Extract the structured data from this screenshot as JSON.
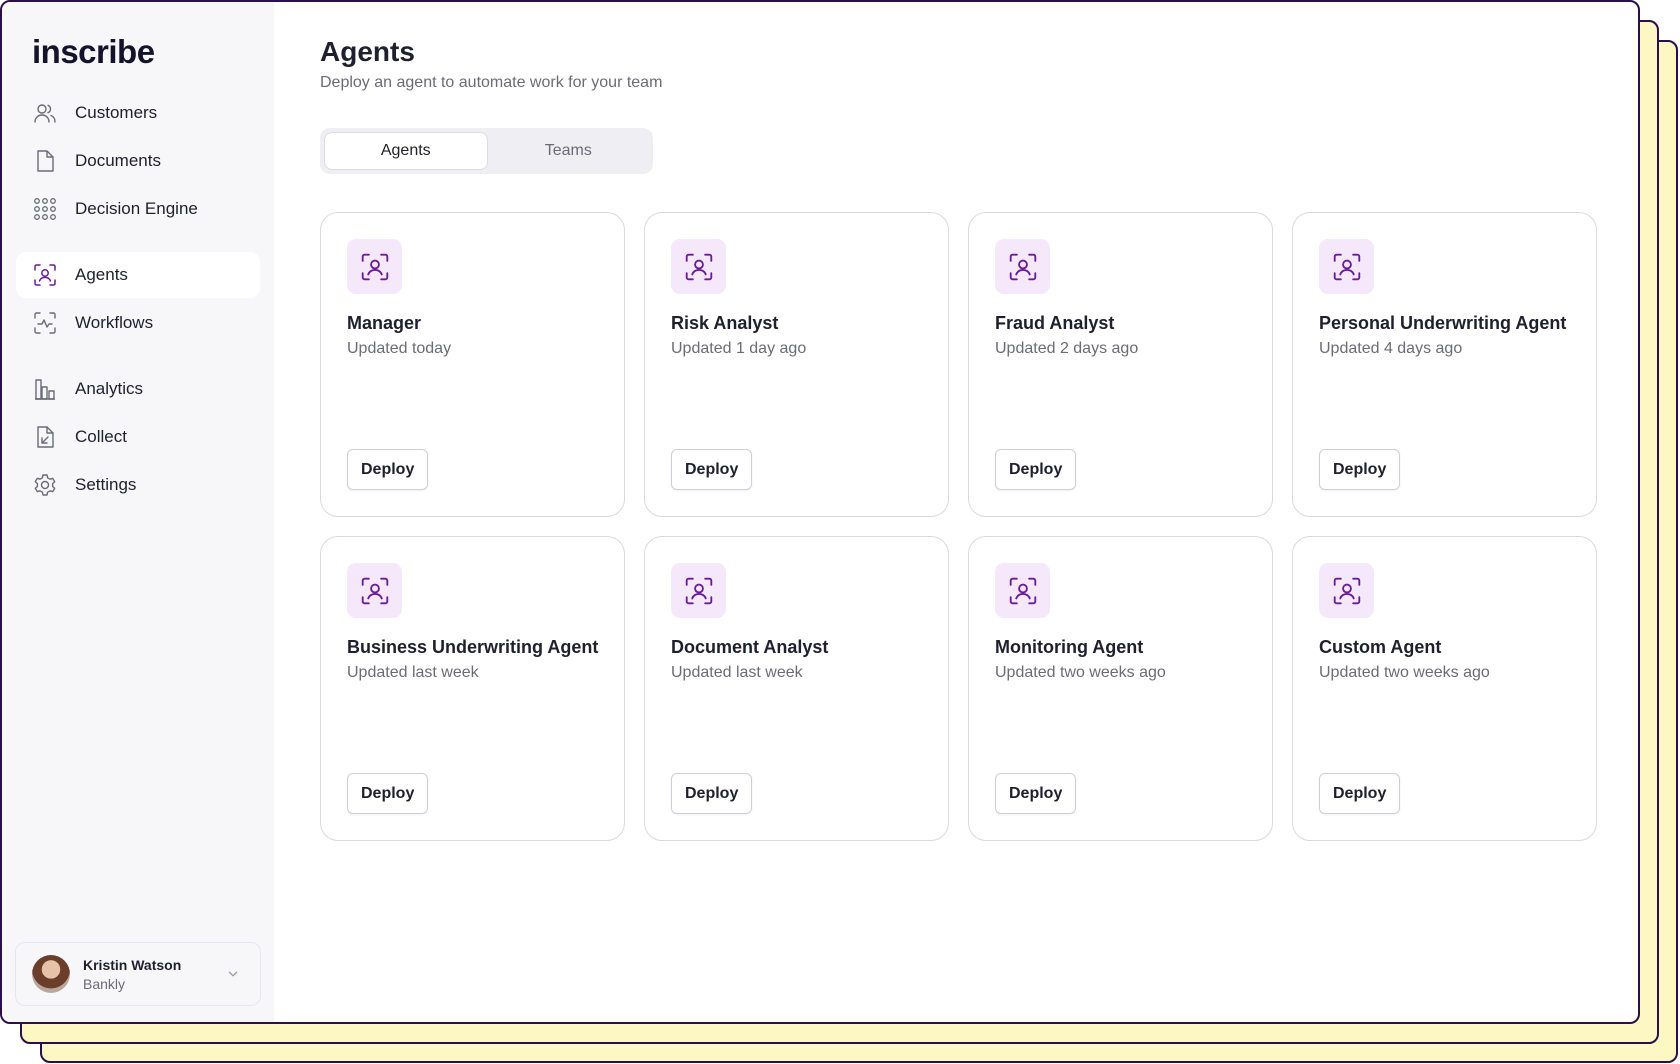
{
  "brand": {
    "name": "inscribe"
  },
  "sidebar": {
    "groups": [
      [
        {
          "label": "Customers",
          "icon": "users-icon"
        },
        {
          "label": "Documents",
          "icon": "document-icon"
        },
        {
          "label": "Decision Engine",
          "icon": "grid-dots-icon"
        }
      ],
      [
        {
          "label": "Agents",
          "icon": "agent-face-scan-icon",
          "active": true
        },
        {
          "label": "Workflows",
          "icon": "workflow-pulse-icon"
        }
      ],
      [
        {
          "label": "Analytics",
          "icon": "bar-chart-icon"
        },
        {
          "label": "Collect",
          "icon": "file-import-icon"
        },
        {
          "label": "Settings",
          "icon": "gear-icon"
        }
      ]
    ],
    "user": {
      "name": "Kristin Watson",
      "org": "Bankly"
    }
  },
  "header": {
    "title": "Agents",
    "subtitle": "Deploy an agent to automate work for your team"
  },
  "tabs": [
    {
      "label": "Agents",
      "active": true
    },
    {
      "label": "Teams",
      "active": false
    }
  ],
  "agents": [
    {
      "name": "Manager",
      "updated": "Updated today",
      "action": "Deploy"
    },
    {
      "name": "Risk Analyst",
      "updated": "Updated 1 day ago",
      "action": "Deploy"
    },
    {
      "name": "Fraud Analyst",
      "updated": "Updated 2 days ago",
      "action": "Deploy"
    },
    {
      "name": "Personal Underwriting Agent",
      "updated": "Updated 4 days ago",
      "action": "Deploy"
    },
    {
      "name": "Business Underwriting Agent",
      "updated": "Updated last week",
      "action": "Deploy"
    },
    {
      "name": "Document Analyst",
      "updated": "Updated last week",
      "action": "Deploy"
    },
    {
      "name": "Monitoring Agent",
      "updated": "Updated two weeks ago",
      "action": "Deploy"
    },
    {
      "name": "Custom Agent",
      "updated": "Updated two weeks ago",
      "action": "Deploy"
    }
  ],
  "colors": {
    "accent": "#6a1b9a",
    "icon_tile": "#f6e8fb",
    "frame_border": "#2a0f4a",
    "backdrop": "#fdf7c3",
    "sidebar_bg": "#f7f7fa"
  }
}
